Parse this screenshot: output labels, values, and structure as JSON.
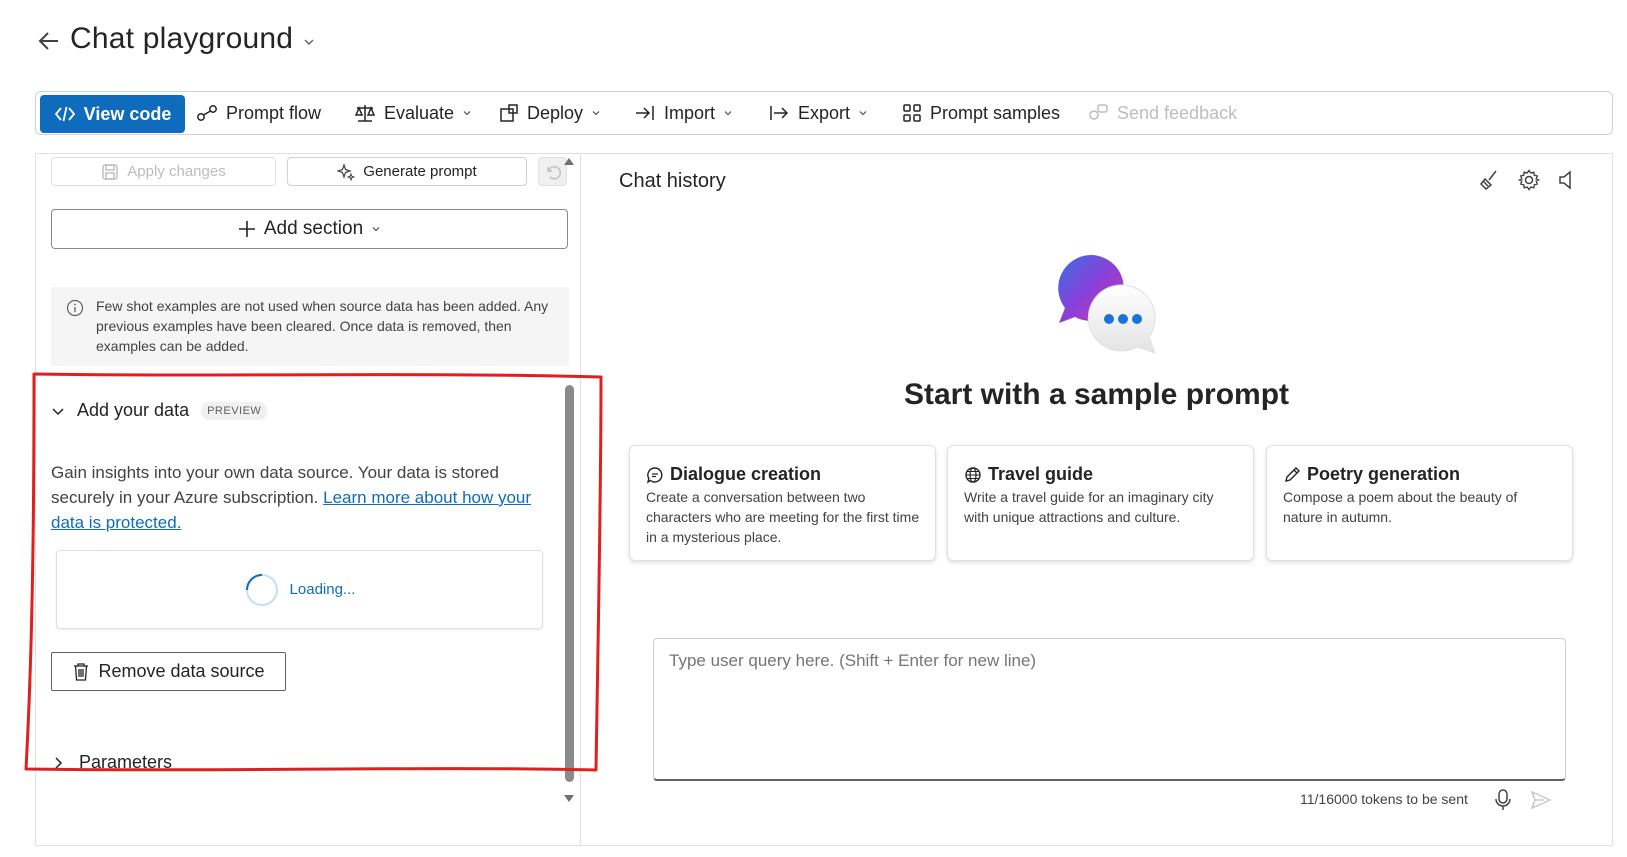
{
  "header": {
    "title": "Chat playground"
  },
  "toolbar": {
    "view_code": "View code",
    "prompt_flow": "Prompt flow",
    "evaluate": "Evaluate",
    "deploy": "Deploy",
    "import": "Import",
    "export": "Export",
    "prompt_samples": "Prompt samples",
    "send_feedback": "Send feedback"
  },
  "setup": {
    "apply_changes": "Apply changes",
    "generate_prompt": "Generate prompt",
    "add_section": "Add section",
    "info_message": "Few shot examples are not used when source data has been added. Any previous examples have been cleared. Once data is removed, then examples can be added.",
    "add_data": {
      "title": "Add your data",
      "badge": "PREVIEW",
      "description": "Gain insights into your own data source. Your data is stored securely in your Azure subscription.",
      "link": "Learn more about how your data is protected.",
      "loading": "Loading...",
      "remove_button": "Remove data source"
    },
    "parameters": "Parameters"
  },
  "chat": {
    "title": "Chat history",
    "heading": "Start with a sample prompt",
    "samples": [
      {
        "title": "Dialogue creation",
        "description": "Create a conversation between two characters who are meeting for the first time in a mysterious place.",
        "icon": "chat-bubble-icon"
      },
      {
        "title": "Travel guide",
        "description": "Write a travel guide for an imaginary city with unique attractions and culture.",
        "icon": "globe-icon"
      },
      {
        "title": "Poetry generation",
        "description": "Compose a poem about the beauty of nature in autumn.",
        "icon": "pencil-icon"
      }
    ],
    "input_placeholder": "Type user query here. (Shift + Enter for new line)",
    "token_count": "11/16000 tokens to be sent"
  },
  "colors": {
    "accent": "#0f6cbd",
    "annotation": "#e02020"
  }
}
